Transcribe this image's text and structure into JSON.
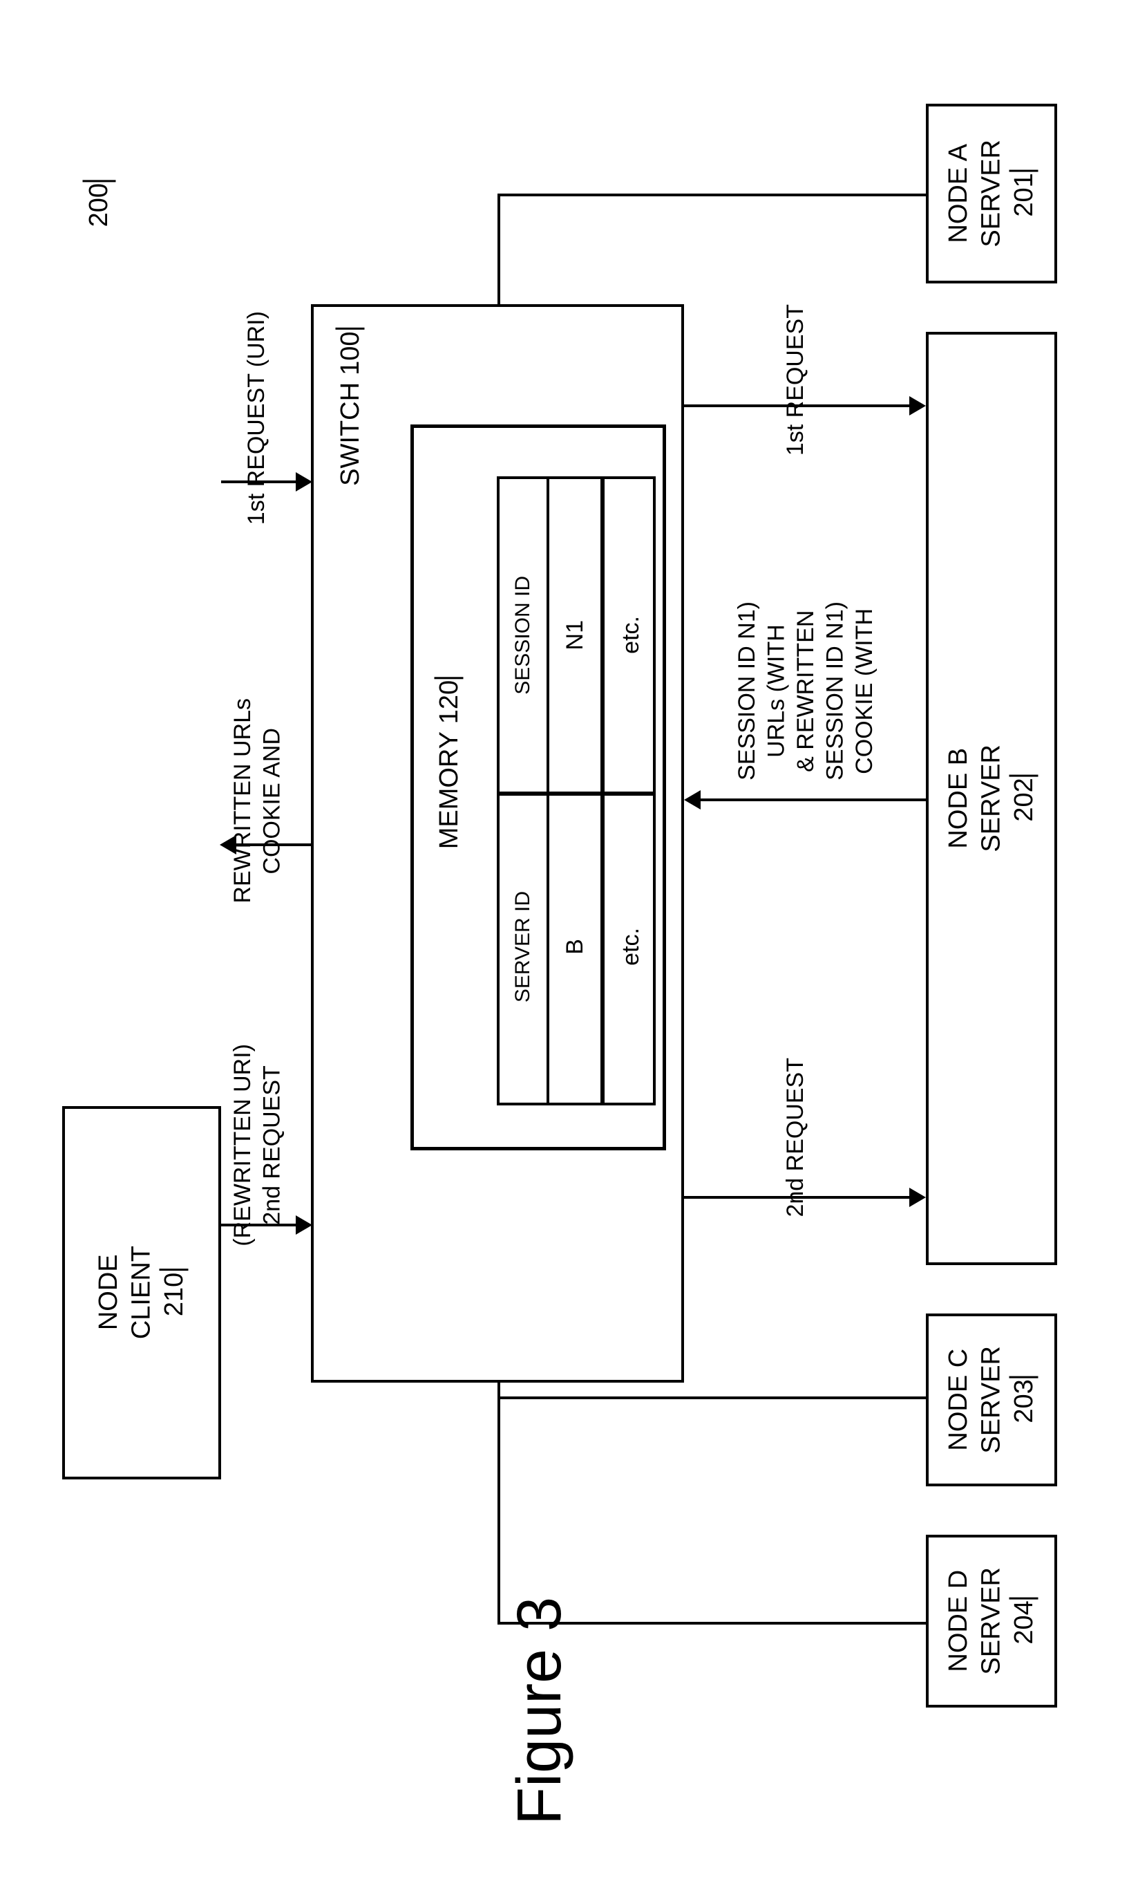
{
  "page_ref": "200",
  "figure_caption": "Figure 3",
  "client": {
    "ref": "210",
    "label": "CLIENT\nNODE"
  },
  "switch": {
    "label": "SWITCH",
    "ref": "100"
  },
  "memory": {
    "label": "MEMORY",
    "ref": "120",
    "columns": [
      "SESSION ID",
      "SERVER ID"
    ],
    "rows": [
      {
        "session": "N1",
        "server": "B"
      },
      {
        "session": "etc.",
        "server": "etc."
      }
    ]
  },
  "servers": [
    {
      "ref": "201",
      "label": "SERVER\nNODE A"
    },
    {
      "ref": "202",
      "label": "SERVER\nNODE B"
    },
    {
      "ref": "203",
      "label": "SERVER\nNODE C"
    },
    {
      "ref": "204",
      "label": "SERVER\nNODE D"
    }
  ],
  "arrows_left": {
    "first_request": "1st REQUEST (URI)",
    "cookie_rewritten": "COOKIE AND\nREWRITTEN URLs",
    "second_request": "2nd REQUEST\n(REWRITTEN URI)"
  },
  "arrows_right": {
    "first_request": "1st REQUEST",
    "cookie_rewritten": "COOKIE (WITH\nSESSION ID N1)\n& REWRITTEN\nURLs (WITH\nSESSION ID N1)",
    "second_request": "2nd REQUEST"
  }
}
